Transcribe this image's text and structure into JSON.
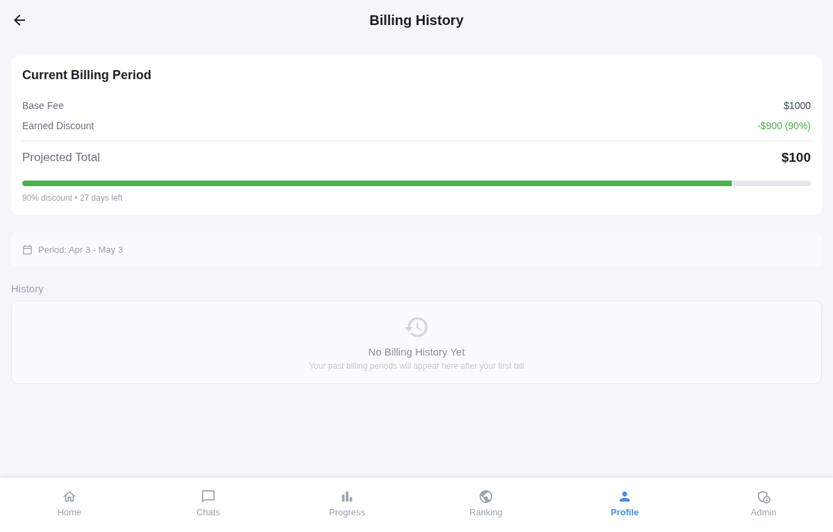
{
  "header": {
    "title": "Billing History"
  },
  "current_period": {
    "title": "Current Billing Period",
    "lines": [
      {
        "label": "Base Fee",
        "value": "$1000",
        "kind": "plain"
      },
      {
        "label": "Earned Discount",
        "value": "-$900 (90%)",
        "kind": "discount"
      }
    ],
    "total": {
      "label": "Projected Total",
      "value": "$100"
    },
    "progress": {
      "level": 0.9,
      "caption": "90% discount • 27 days left"
    }
  },
  "period": {
    "text": "Period: Apr 3 - May 3"
  },
  "history": {
    "heading": "History",
    "empty_title": "No Billing History Yet",
    "empty_message": "Your past billing periods will appear here after your first bill"
  },
  "nav": [
    {
      "label": "Home",
      "selected": false
    },
    {
      "label": "Chats",
      "selected": false
    },
    {
      "label": "Progress",
      "selected": false
    },
    {
      "label": "Ranking",
      "selected": false
    },
    {
      "label": "Profile",
      "selected": true
    },
    {
      "label": "Admin",
      "selected": false
    }
  ]
}
